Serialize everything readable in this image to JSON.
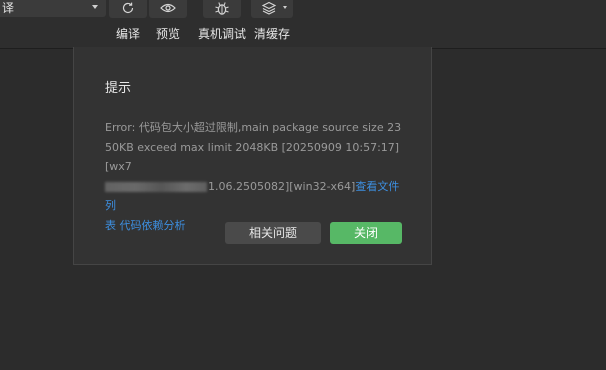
{
  "toolbar": {
    "mode_select": {
      "value": "译"
    },
    "compile": {
      "label": "编译",
      "icon": "refresh-icon"
    },
    "preview": {
      "label": "预览",
      "icon": "eye-icon"
    },
    "real_debug": {
      "label": "真机调试",
      "icon": "bug-icon"
    },
    "clear_cache": {
      "label": "清缓存",
      "icon": "layers-icon"
    }
  },
  "dialog": {
    "title": "提示",
    "message_line1": "Error: 代码包大小超过限制,main package source size 23",
    "message_line2": "50KB exceed max limit 2048KB [20250909 10:57:17][wx7",
    "message_line3_tail": "1.06.2505082][win32-x64]",
    "link_file_list_part1": "查看文件列",
    "link_file_list_part2": "表",
    "link_dependency_analysis": "代码依赖分析",
    "related_button": "相关问题",
    "close_button": "关闭"
  },
  "colors": {
    "background": "#2c2c2c",
    "dialog_bg": "#333333",
    "link": "#3d8fe0",
    "primary_button": "#57b866",
    "secondary_button": "#4a4a4a"
  }
}
